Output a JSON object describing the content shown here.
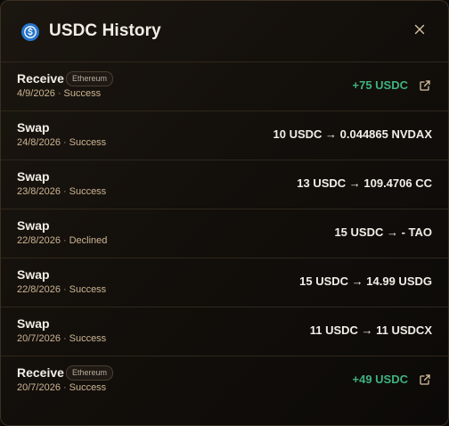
{
  "header": {
    "title": "USDC History",
    "icon": "usdc-coin-icon",
    "close_icon": "close-icon"
  },
  "colors": {
    "positive": "#3fb27f",
    "accent_meta": "#cdb694",
    "usdc_blue": "#2775ca"
  },
  "transactions": [
    {
      "type": "Receive",
      "network": "Ethereum",
      "date": "4/9/2026",
      "status": "Success",
      "amount": "+75 USDC",
      "positive": true,
      "link_icon": "external-link-icon"
    },
    {
      "type": "Swap",
      "date": "24/8/2026",
      "status": "Success",
      "amount": "10 USDC → 0.044865 NVDAX"
    },
    {
      "type": "Swap",
      "date": "23/8/2026",
      "status": "Success",
      "amount": "13 USDC → 109.4706 CC"
    },
    {
      "type": "Swap",
      "date": "22/8/2026",
      "status": "Declined",
      "amount": "15 USDC → - TAO"
    },
    {
      "type": "Swap",
      "date": "22/8/2026",
      "status": "Success",
      "amount": "15 USDC → 14.99 USDG"
    },
    {
      "type": "Swap",
      "date": "20/7/2026",
      "status": "Success",
      "amount": "11 USDC → 11 USDCX"
    },
    {
      "type": "Receive",
      "network": "Ethereum",
      "date": "20/7/2026",
      "status": "Success",
      "amount": "+49 USDC",
      "positive": true,
      "link_icon": "external-link-icon"
    }
  ]
}
